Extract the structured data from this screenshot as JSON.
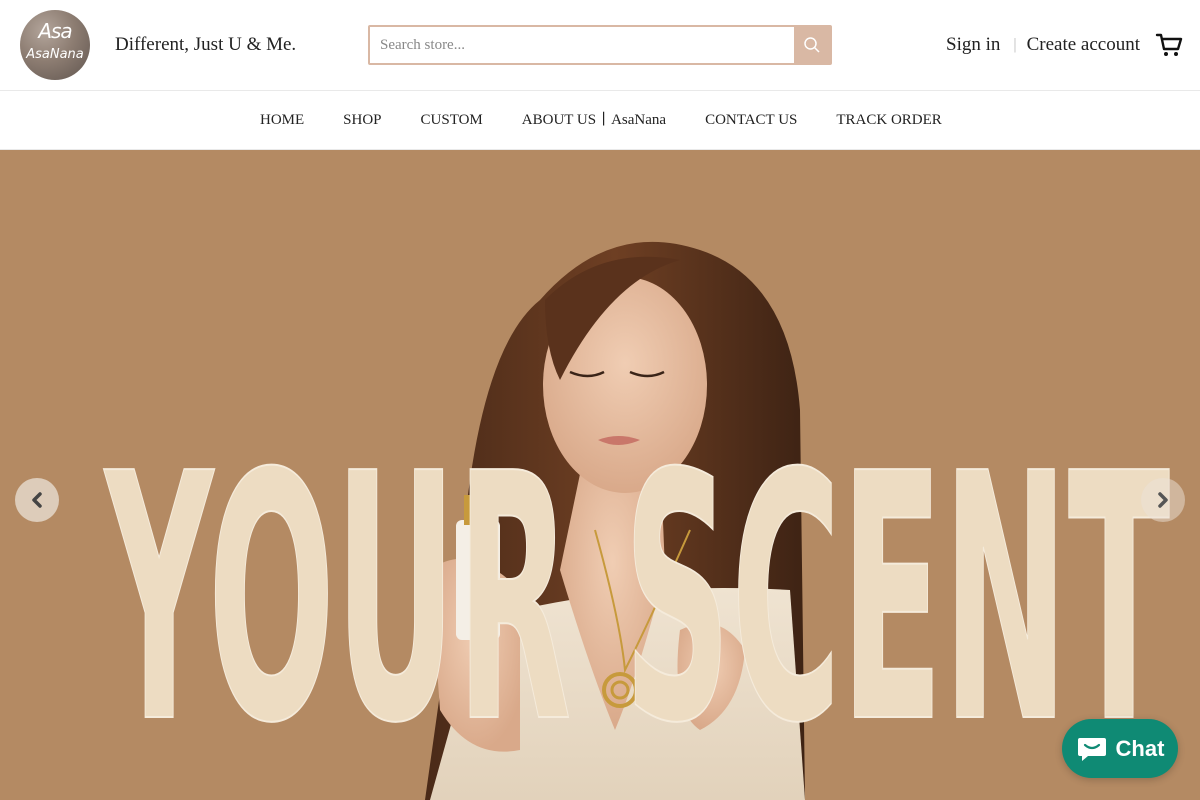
{
  "brand": {
    "logo_top": "Asa",
    "logo_bottom": "AsaNana",
    "tagline": "Different, Just U & Me."
  },
  "search": {
    "placeholder": "Search store...",
    "value": ""
  },
  "account": {
    "sign_in": "Sign in",
    "separator": "|",
    "create": "Create account"
  },
  "nav": {
    "items": [
      "HOME",
      "SHOP",
      "CUSTOM",
      "ABOUT US丨AsaNana",
      "CONTACT US",
      "TRACK ORDER"
    ]
  },
  "hero": {
    "headline": "YOUR SCENT",
    "background": "#b48a63",
    "text_color": "#eddcc2"
  },
  "chat": {
    "label": "Chat",
    "color": "#0f8a74"
  },
  "colors": {
    "accent": "#d9b8a4"
  },
  "icons": {
    "search": "search-icon",
    "cart": "cart-icon",
    "prev": "chevron-left-icon",
    "next": "chevron-right-icon",
    "chat": "chat-bubble-icon"
  }
}
